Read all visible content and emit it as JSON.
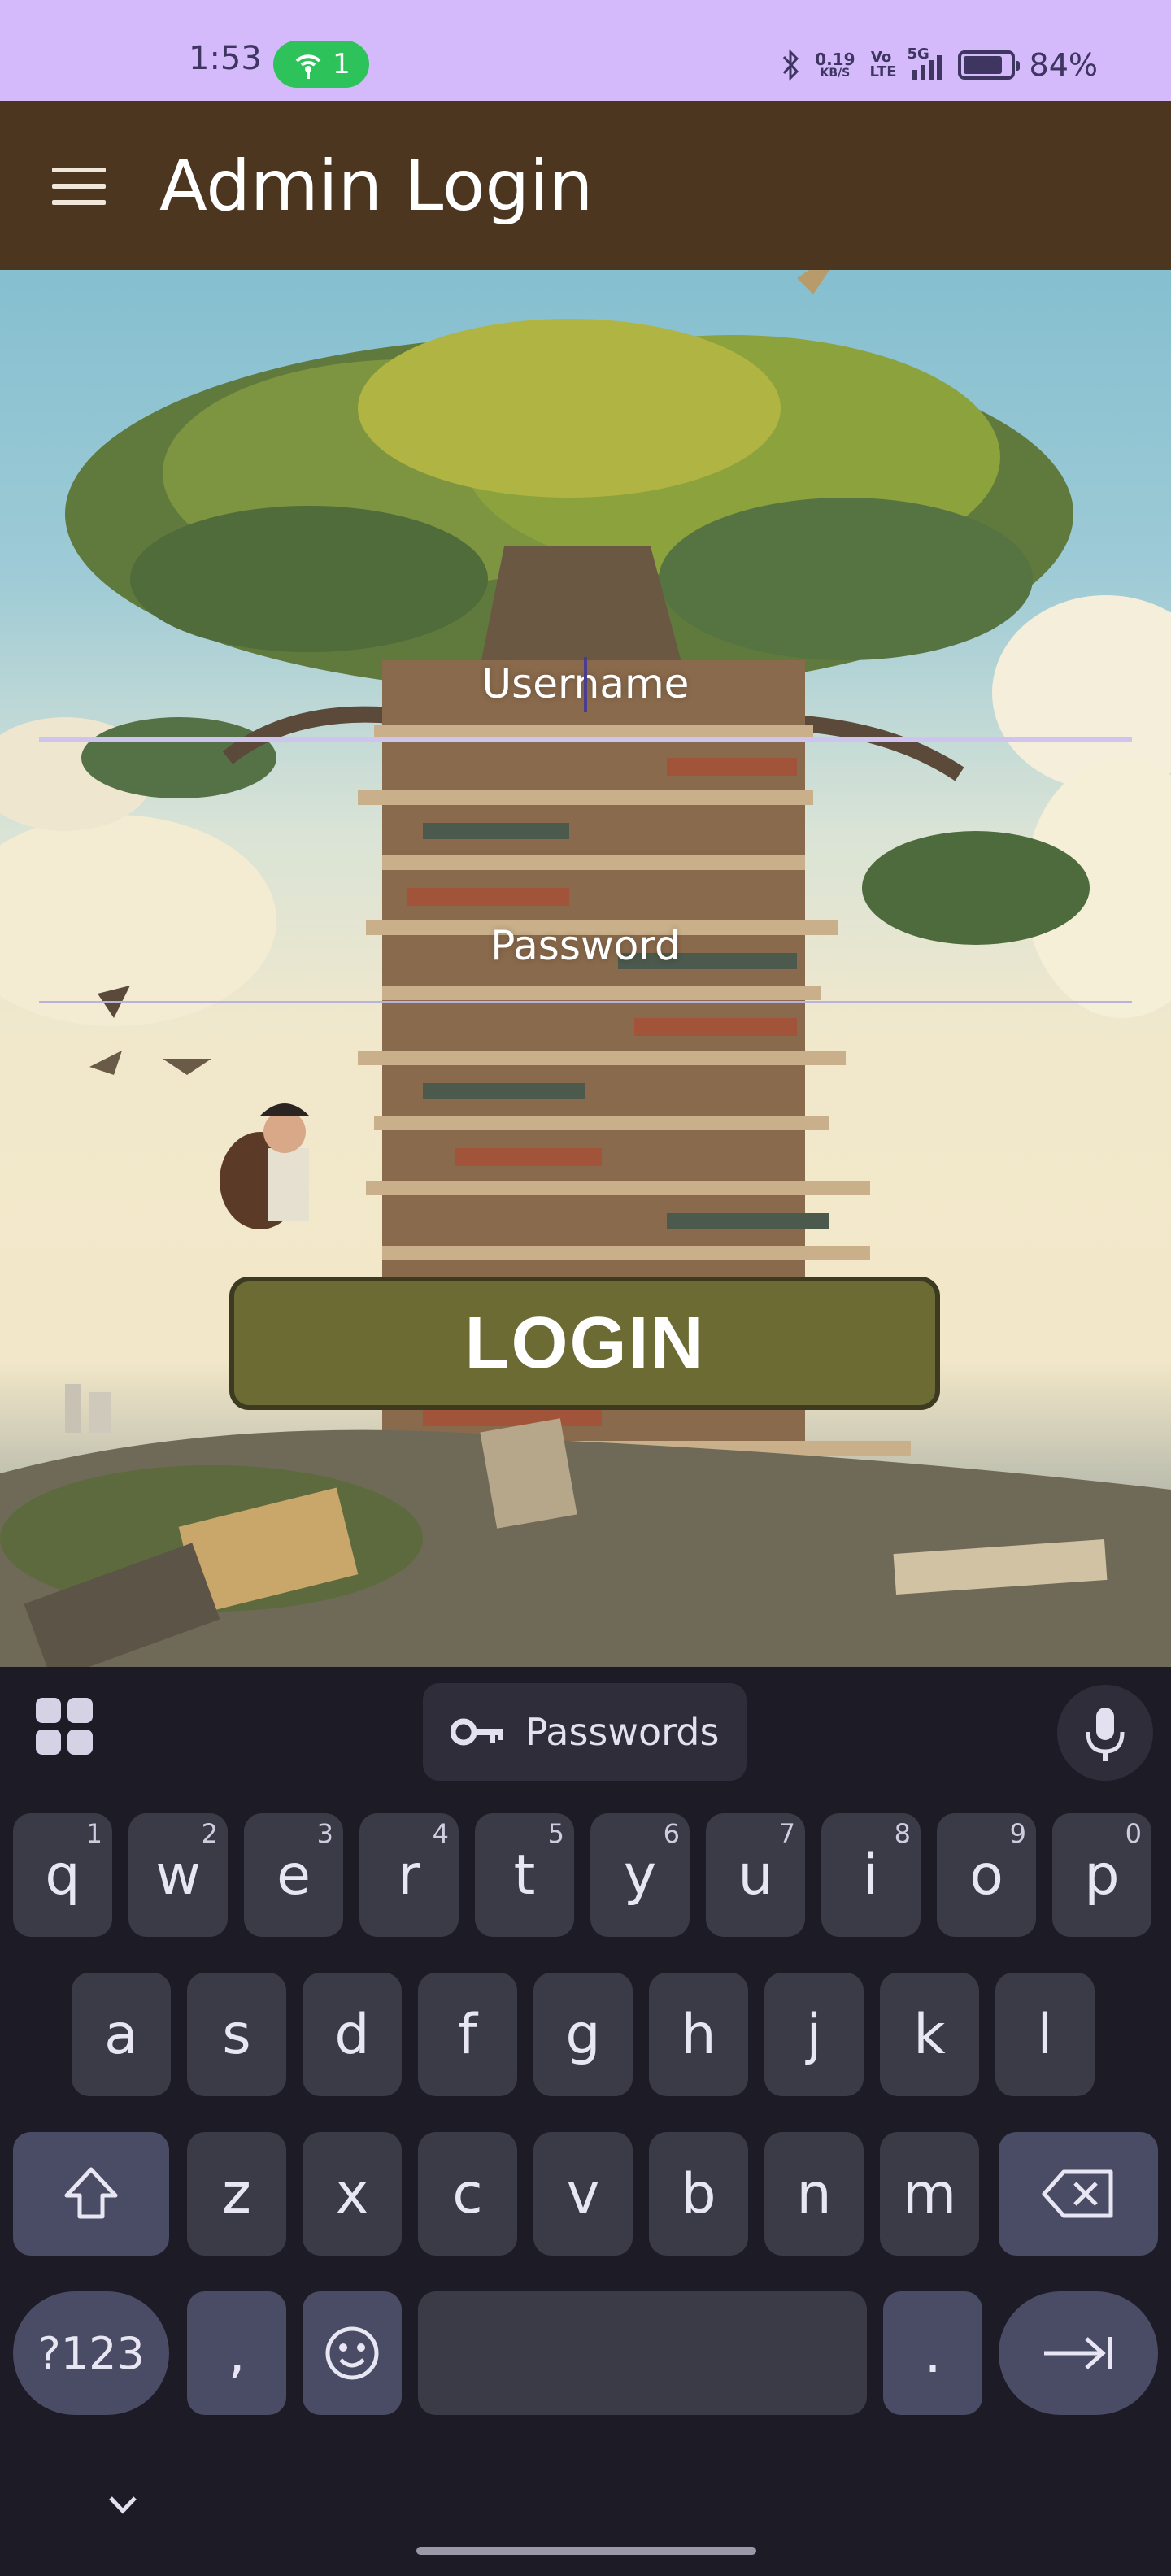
{
  "status_bar": {
    "time": "1:53",
    "hotspot_count": "1",
    "net_speed_value": "0.19",
    "net_speed_unit": "KB/S",
    "volte": "Vo LTE",
    "network": "5G",
    "battery_percent": "84%",
    "battery_level": 0.84,
    "icons": [
      "hotspot-icon",
      "bluetooth-icon",
      "signal-icon",
      "battery-icon"
    ]
  },
  "app_bar": {
    "title": "Admin Login",
    "menu_icon": "menu-icon"
  },
  "login_form": {
    "username_placeholder": "Username",
    "password_placeholder": "Password",
    "login_button": "LOGIN"
  },
  "keyboard": {
    "toolbar": {
      "passwords_chip": "Passwords",
      "icons": [
        "apps-grid-icon",
        "key-icon",
        "mic-icon"
      ]
    },
    "row1": [
      {
        "key": "q",
        "hint": "1"
      },
      {
        "key": "w",
        "hint": "2"
      },
      {
        "key": "e",
        "hint": "3"
      },
      {
        "key": "r",
        "hint": "4"
      },
      {
        "key": "t",
        "hint": "5"
      },
      {
        "key": "y",
        "hint": "6"
      },
      {
        "key": "u",
        "hint": "7"
      },
      {
        "key": "i",
        "hint": "8"
      },
      {
        "key": "o",
        "hint": "9"
      },
      {
        "key": "p",
        "hint": "0"
      }
    ],
    "row2": [
      "a",
      "s",
      "d",
      "f",
      "g",
      "h",
      "j",
      "k",
      "l"
    ],
    "row3": [
      "z",
      "x",
      "c",
      "v",
      "b",
      "n",
      "m"
    ],
    "row4": {
      "symbols": "?123",
      "comma": ",",
      "period": "."
    },
    "icons": [
      "shift-icon",
      "backspace-icon",
      "emoji-icon",
      "enter-tab-icon",
      "chevron-down-icon"
    ]
  }
}
